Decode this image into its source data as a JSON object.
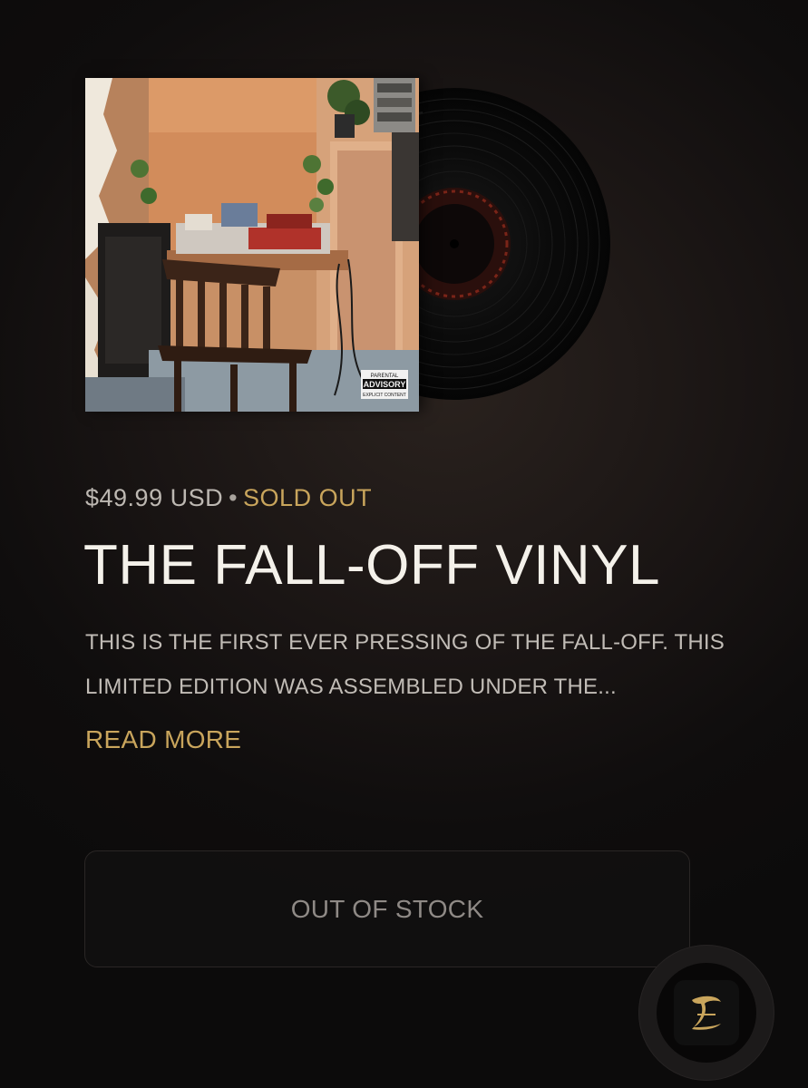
{
  "product": {
    "price": "$49.99 USD",
    "separator": "•",
    "status": "SOLD OUT",
    "title": "THE FALL-OFF VINYL",
    "description": "THIS IS THE FIRST EVER PRESSING OF THE FALL-OFF. THIS LIMITED EDITION WAS ASSEMBLED UNDER THE...",
    "read_more_label": "READ MORE",
    "button_label": "OUT OF STOCK",
    "cover_badge": [
      "PARENTAL",
      "ADVISORY",
      "EXPLICIT CONTENT"
    ]
  },
  "colors": {
    "accent": "#c9a55c",
    "background": "#0f0d0d",
    "text": "#f4f1ea",
    "muted": "#bdb8b2"
  },
  "icons": {
    "floating": "dreamville-logo-icon"
  }
}
